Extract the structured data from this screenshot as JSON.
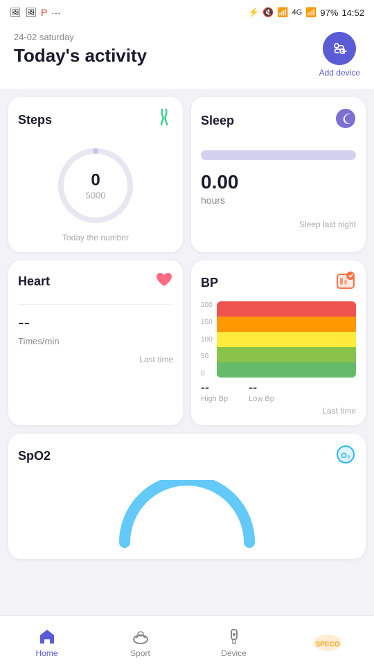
{
  "statusBar": {
    "time": "14:52",
    "battery": "97%",
    "signal": "4G"
  },
  "header": {
    "date": "24-02 saturday",
    "title": "Today's activity",
    "addDeviceLabel": "Add device"
  },
  "steps": {
    "title": "Steps",
    "value": "0",
    "goal": "5000",
    "footerLabel": "Today the number"
  },
  "sleep": {
    "title": "Sleep",
    "value": "0.00",
    "unit": "hours",
    "footerLabel": "Sleep last night"
  },
  "heart": {
    "title": "Heart",
    "value": "--",
    "unit": "Times/min",
    "footerLabel": "Last time"
  },
  "bp": {
    "title": "BP",
    "highValue": "--",
    "lowValue": "--",
    "highLabel": "High Bp",
    "lowLabel": "Low Bp",
    "footerLabel": "Last time",
    "chartLabels": [
      "200",
      "150",
      "100",
      "50",
      "0"
    ]
  },
  "spo2": {
    "title": "SpO2"
  },
  "nav": {
    "items": [
      {
        "label": "Home",
        "active": true
      },
      {
        "label": "Sport",
        "active": false
      },
      {
        "label": "Device",
        "active": false
      },
      {
        "label": "",
        "active": false
      }
    ]
  }
}
